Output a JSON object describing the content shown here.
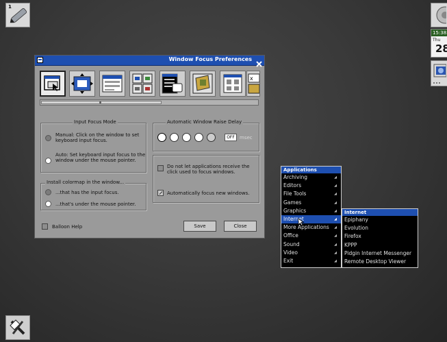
{
  "desktop": {
    "workspace_number": "1",
    "clock_time": "15:38",
    "clock_day": "Thu",
    "clock_date": "28"
  },
  "dialog": {
    "title": "Window Focus Preferences",
    "input_focus_mode": {
      "legend": "Input Focus Mode",
      "options": [
        {
          "label": "Manual:  Click on the window to set keyboard input focus.",
          "selected": false
        },
        {
          "label": "Auto:  Set keyboard input focus to the window under the mouse pointer.",
          "selected": true
        }
      ]
    },
    "raise_delay": {
      "legend": "Automatic Window Raise Delay",
      "value": "OFF",
      "unit": "msec",
      "selected_index": 0
    },
    "colormap": {
      "legend": "Install colormap in the window...",
      "options": [
        {
          "label": "...that has the input focus.",
          "selected": false
        },
        {
          "label": "...that's under the mouse pointer.",
          "selected": true
        }
      ]
    },
    "checkboxes": [
      {
        "label": "Do not let applications receive the click used to focus windows.",
        "checked": false
      },
      {
        "label": "Automatically focus new windows.",
        "checked": true
      }
    ],
    "balloon_help": {
      "label": "Balloon Help",
      "checked": false
    },
    "save_label": "Save",
    "close_label": "Close"
  },
  "applications_menu": {
    "title": "Applications",
    "items": [
      "Archiving",
      "Editors",
      "File Tools",
      "Games",
      "Graphics",
      "Internet",
      "More Applications",
      "Office",
      "Sound",
      "Video",
      "Exit"
    ],
    "highlighted": "Internet"
  },
  "internet_menu": {
    "title": "Internet",
    "items": [
      "Epiphany",
      "Evolution",
      "Firefox",
      "KPPP",
      "Pidgin Internet Messenger",
      "Remote Desktop Viewer"
    ]
  },
  "colors": {
    "accent": "#1e4fb0",
    "dialog_bg": "#9a9a9a",
    "menu_bg": "#000000"
  }
}
